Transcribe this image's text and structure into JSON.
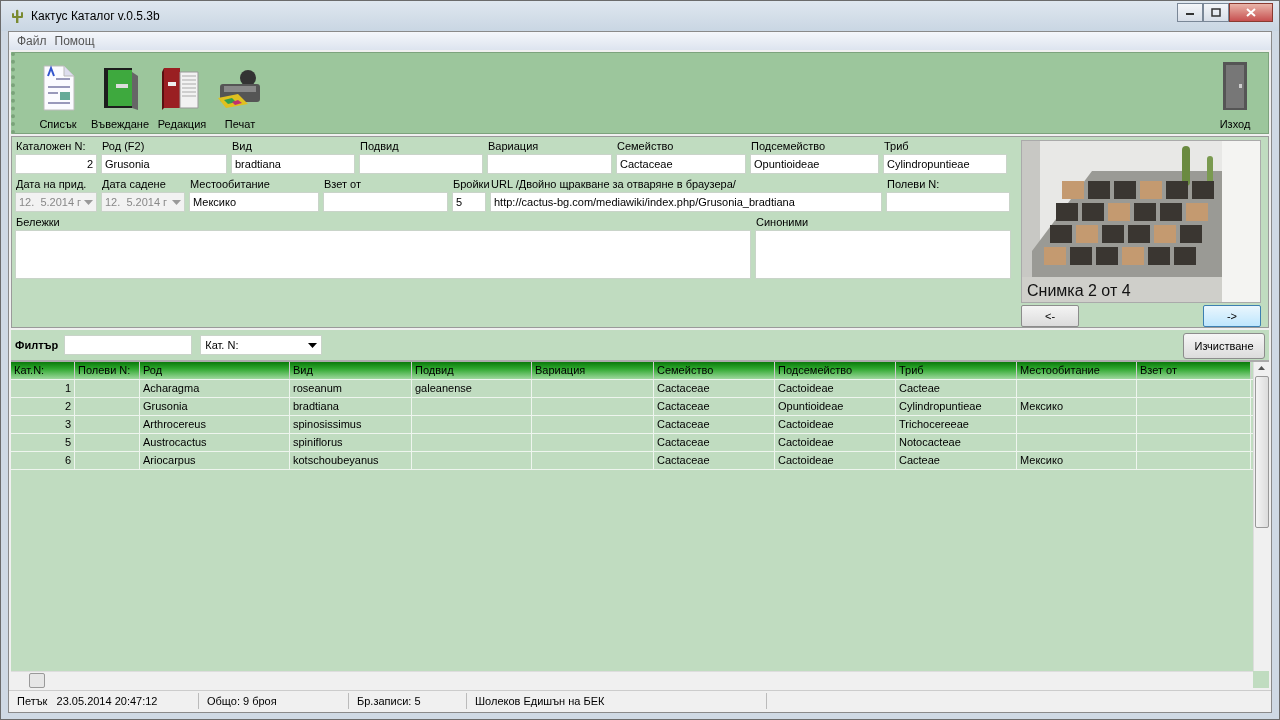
{
  "window": {
    "title": "Кактус Каталог v.0.5.3b"
  },
  "menu": [
    "Файл",
    "Помощ"
  ],
  "toolbar": [
    {
      "label": "Списък",
      "kind": "document"
    },
    {
      "label": "Въвеждане",
      "kind": "green-book"
    },
    {
      "label": "Редакция",
      "kind": "red-book"
    },
    {
      "label": "Печат",
      "kind": "printer"
    },
    {
      "label": "Изход",
      "kind": "door"
    }
  ],
  "form": {
    "top_line": [
      {
        "label": "Каталожен N:",
        "value": "2",
        "kind": "number"
      },
      {
        "label": "Род (F2)",
        "value": "Grusonia",
        "kind": "text"
      },
      {
        "label": "Вид",
        "value": "bradtiana",
        "kind": "text"
      },
      {
        "label": "Подвид",
        "kind": "text"
      },
      {
        "label": "Вариация",
        "kind": "text"
      },
      {
        "label": "Семейство",
        "value": "Cactaceae",
        "kind": "text"
      },
      {
        "label": "Подсемейство",
        "value": "Opuntioideae",
        "kind": "text"
      },
      {
        "label": "Триб",
        "value": "Cylindropuntieae",
        "kind": "text"
      }
    ],
    "middle_line": [
      {
        "label": "Дата на прид.",
        "value": "12.  5.2014 г",
        "kind": "date",
        "disabled": true
      },
      {
        "label": "Дата садене",
        "value": "12.  5.2014 г",
        "kind": "date",
        "disabled": true
      },
      {
        "label": "Местообитание",
        "value": "Мексико",
        "kind": "text"
      },
      {
        "label": "Взет от",
        "kind": "text"
      },
      {
        "label": "Бройки",
        "value": "5",
        "kind": "text"
      },
      {
        "label": "URL /Двойно щракване за отваряне в браузера/",
        "value": "http://cactus-bg.com/mediawiki/index.php/Grusonia_bradtiana",
        "kind": "text"
      },
      {
        "label": "Полеви N:",
        "kind": "text"
      }
    ],
    "bottom_line": [
      {
        "label": "Бележки",
        "kind": "memo"
      },
      {
        "label": "Синоними",
        "kind": "memo"
      }
    ]
  },
  "photo": {
    "kind": "picture",
    "caption": "Снимка 2 от 4",
    "prev": "<-",
    "next": "->"
  },
  "filter": {
    "label": "Филтър",
    "field": "Кат. N:",
    "clear_button": "Изчистване"
  },
  "table": {
    "columns": [
      "Кат.N:",
      "Полеви N:",
      "Род",
      "Вид",
      "Подвид",
      "Вариация",
      "Семейство",
      "Подсемейство",
      "Триб",
      "Местообитание",
      "Взет от"
    ],
    "rows": [
      [
        "1",
        "",
        "Acharagma",
        "roseanum",
        "galeanense",
        "",
        "Cactaceae",
        "Cactoideae",
        "Cacteae",
        "",
        ""
      ],
      [
        "2",
        "",
        "Grusonia",
        "bradtiana",
        "",
        "",
        "Cactaceae",
        "Opuntioideae",
        "Cylindropuntieae",
        "Мексико",
        ""
      ],
      [
        "3",
        "",
        "Arthrocereus",
        "spinosissimus",
        "",
        "",
        "Cactaceae",
        "Cactoideae",
        "Trichocereeae",
        "",
        ""
      ],
      [
        "5",
        "",
        "Austrocactus",
        "spiniflorus",
        "",
        "",
        "Cactaceae",
        "Cactoideae",
        "Notocacteae",
        "",
        ""
      ],
      [
        "6",
        "",
        "Ariocarpus",
        "kotschoubeyanus",
        "",
        "",
        "Cactaceae",
        "Cactoideae",
        "Cacteae",
        "Мексико",
        ""
      ]
    ]
  },
  "status_bar": [
    "Петък   23.05.2014 20:47:12",
    "Общо: 9 броя",
    "Бр.записи: 5",
    "Шолеков Едишън на БЕК"
  ]
}
